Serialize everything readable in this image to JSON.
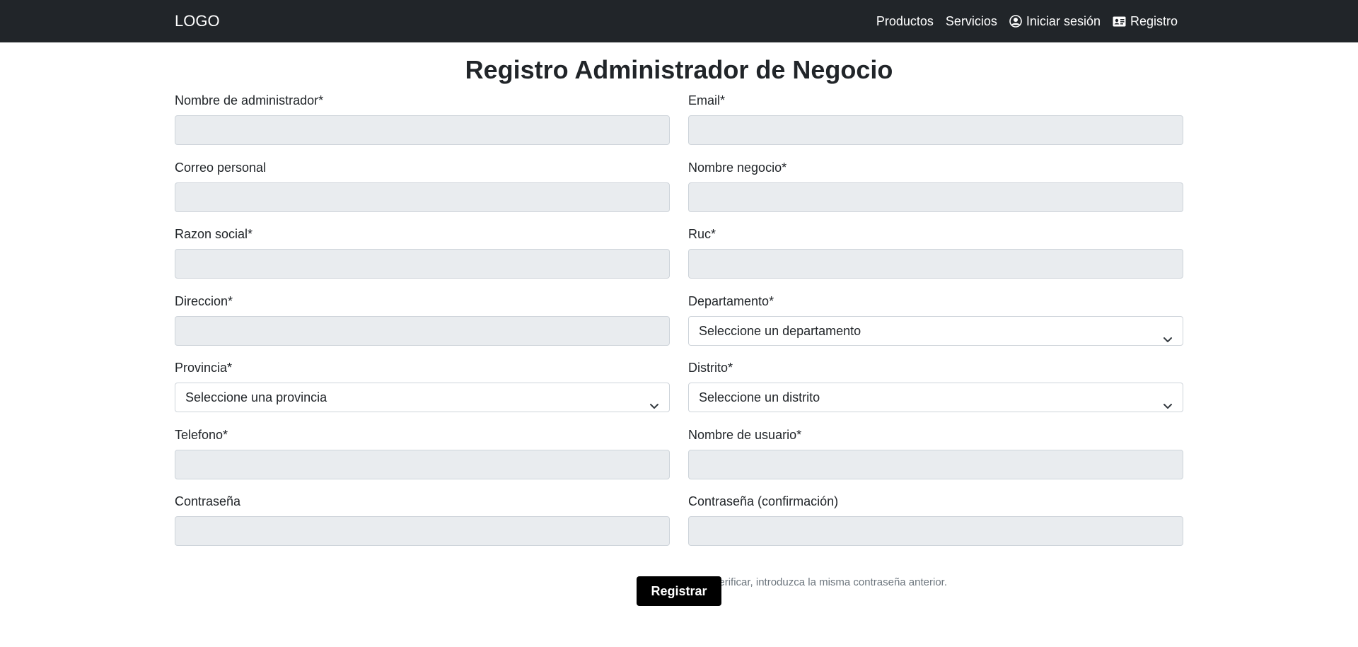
{
  "navbar": {
    "logo": "LOGO",
    "links": [
      {
        "label": "Productos",
        "icon": null
      },
      {
        "label": "Servicios",
        "icon": null
      },
      {
        "label": "Iniciar sesión",
        "icon": "user-circle-icon"
      },
      {
        "label": "Registro",
        "icon": "id-card-icon"
      }
    ]
  },
  "page": {
    "title": "Registro Administrador de Negocio"
  },
  "form": {
    "fields": [
      {
        "label": "Nombre de administrador*",
        "type": "input",
        "value": ""
      },
      {
        "label": "Email*",
        "type": "input",
        "value": ""
      },
      {
        "label": "Correo personal",
        "type": "input",
        "value": ""
      },
      {
        "label": "Nombre negocio*",
        "type": "input",
        "value": ""
      },
      {
        "label": "Razon social*",
        "type": "input",
        "value": ""
      },
      {
        "label": "Ruc*",
        "type": "input",
        "value": ""
      },
      {
        "label": "Direccion*",
        "type": "input",
        "value": ""
      },
      {
        "label": "Departamento*",
        "type": "select",
        "value": "Seleccione un departamento"
      },
      {
        "label": "Provincia*",
        "type": "select",
        "value": "Seleccione una provincia"
      },
      {
        "label": "Distrito*",
        "type": "select",
        "value": "Seleccione un distrito"
      },
      {
        "label": "Telefono*",
        "type": "input",
        "value": ""
      },
      {
        "label": "Nombre de usuario*",
        "type": "input",
        "value": ""
      },
      {
        "label": "Contraseña",
        "type": "input",
        "value": ""
      },
      {
        "label": "Contraseña (confirmación)",
        "type": "input",
        "value": ""
      }
    ],
    "password_confirm_help": "Para verificar, introduzca la misma contraseña anterior.",
    "submit_label": "Registrar"
  },
  "colors": {
    "navbar_bg": "#212529",
    "input_disabled_bg": "#e9ecef",
    "button_bg": "#000000",
    "help_text": "#6c757d"
  }
}
